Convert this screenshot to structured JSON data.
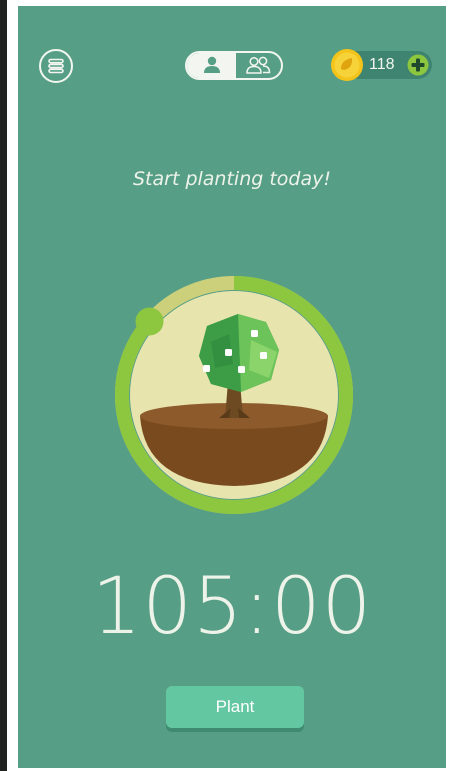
{
  "header": {
    "menu_icon": "menu-icon",
    "mode_toggle": {
      "selected": "solo",
      "solo_icon": "person-icon",
      "group_icon": "group-icon"
    },
    "coins": {
      "icon": "coin-icon",
      "count": "118",
      "add_icon": "plus-circle-icon"
    }
  },
  "main": {
    "tagline": "Start planting today!",
    "timer": "105:00",
    "plant_label": "Plant"
  },
  "colors": {
    "background": "#569f86",
    "ring_green": "#8dc63f",
    "ring_track": "#cdd07b",
    "soil": "#7a4a1f",
    "button": "#63c7a2",
    "coin": "#f4c41a"
  }
}
